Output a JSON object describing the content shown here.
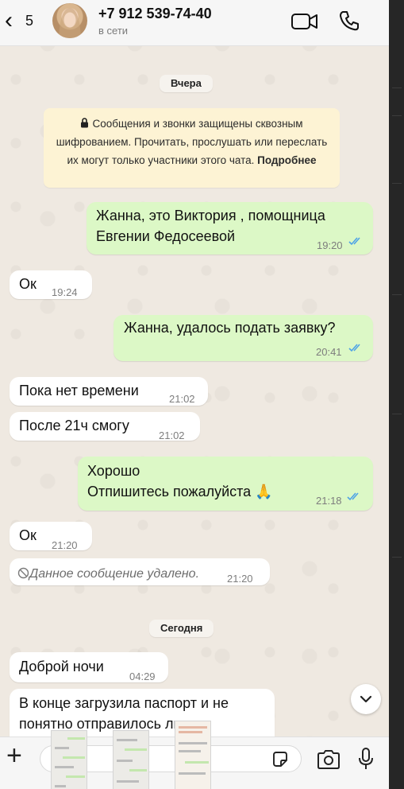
{
  "header": {
    "back_count": "5",
    "contact_name": "+7 912 539-74-40",
    "status": "в сети",
    "icons": [
      "back-chevron-icon",
      "video-call-icon",
      "phone-call-icon"
    ]
  },
  "chips": {
    "yesterday": "Вчера",
    "today": "Сегодня"
  },
  "encryption": {
    "text": "Сообщения и звонки защищены сквозным шифрованием. Прочитать, прослушать или переслать их могут только участники этого чата.",
    "link": "Подробнее",
    "icon": "lock-icon"
  },
  "messages": [
    {
      "dir": "out",
      "lines": [
        "Жанна, это Виктория , помощница",
        "Евгении Федосеевой"
      ],
      "time": "19:20",
      "read": true
    },
    {
      "dir": "in",
      "lines": [
        "Ок"
      ],
      "time": "19:24"
    },
    {
      "dir": "out",
      "lines": [
        "Жанна, удалось подать заявку?"
      ],
      "time": "20:41",
      "read": true
    },
    {
      "dir": "in",
      "lines": [
        "Пока нет времени"
      ],
      "time": "21:02"
    },
    {
      "dir": "in",
      "lines": [
        "После 21ч смогу"
      ],
      "time": "21:02"
    },
    {
      "dir": "out",
      "lines": [
        "Хорошо",
        "Отпишитесь пожалуйста 🙏"
      ],
      "time": "21:18",
      "read": true
    },
    {
      "dir": "in",
      "lines": [
        "Ок"
      ],
      "time": "21:20"
    },
    {
      "dir": "in",
      "lines": [
        "Данное сообщение удалено."
      ],
      "time": "21:20",
      "deleted": true
    },
    {
      "dir": "in",
      "lines": [
        "Доброй ночи"
      ],
      "time": "04:29"
    },
    {
      "dir": "in",
      "lines": [
        "В конце загрузила паспорт и не",
        "понятно отправилось ли на"
      ],
      "time": ""
    }
  ],
  "composer": {
    "icons": [
      "plus-icon",
      "sticker-icon",
      "camera-icon",
      "microphone-icon"
    ]
  },
  "colors": {
    "incoming": "#ffffff",
    "outgoing": "#dcf8c6",
    "read_check": "#4fa3e6",
    "background": "#efe9e1"
  }
}
